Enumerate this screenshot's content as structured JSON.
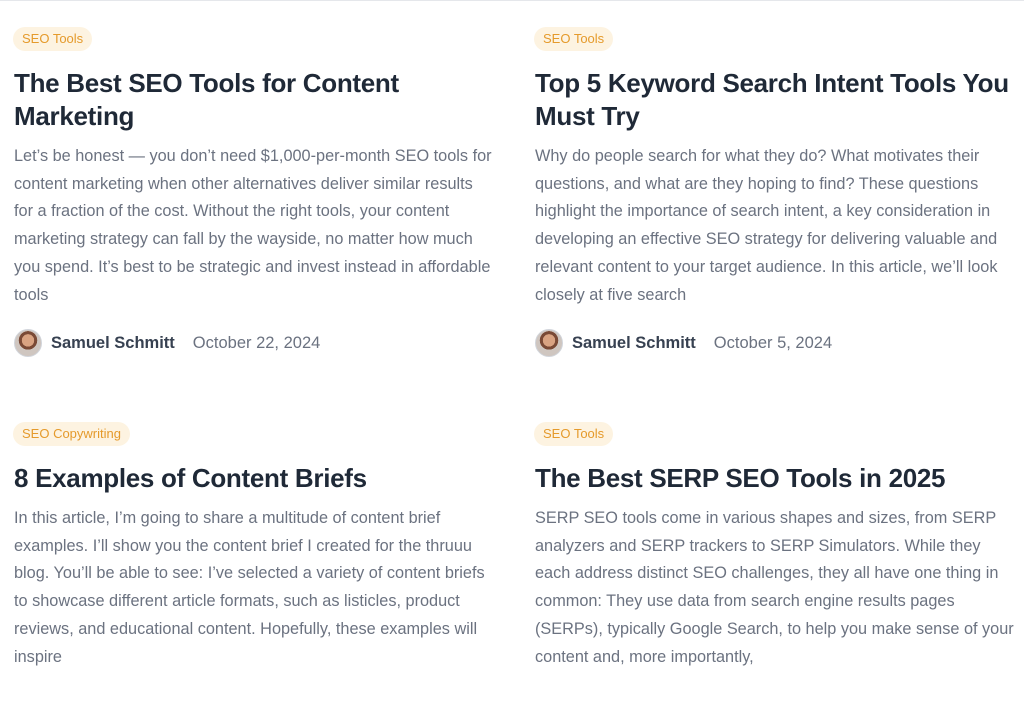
{
  "posts": [
    {
      "category": "SEO Tools",
      "title": "The Best SEO Tools for Content Marketing",
      "excerpt": "Let’s be honest — you don’t need $1,000-per-month SEO tools for content marketing when other alternatives deliver similar results for a fraction of the cost.  Without the right tools, your content marketing strategy can fall by the wayside, no matter how much you spend. It’s best to be strategic and invest instead in affordable tools",
      "author": "Samuel Schmitt",
      "date": "October 22, 2024"
    },
    {
      "category": "SEO Tools",
      "title": "Top 5 Keyword Search Intent Tools You Must Try",
      "excerpt": "Why do people search for what they do? What motivates their questions, and what are they hoping to find? These questions highlight the importance of search intent, a key consideration in developing an effective SEO strategy for delivering valuable and relevant content to your target audience.  In this article, we’ll look closely at five search",
      "author": "Samuel Schmitt",
      "date": "October 5, 2024"
    },
    {
      "category": "SEO Copywriting",
      "title": "8 Examples of Content Briefs",
      "excerpt": "In this article, I’m going to share a multitude of content brief examples. I’ll show you the content brief I created for the thruuu blog. You’ll be able to see: I’ve selected a variety of content briefs to showcase different article formats, such as listicles, product reviews, and educational content. Hopefully, these examples will inspire"
    },
    {
      "category": "SEO Tools",
      "title": "The Best SERP SEO Tools in 2025",
      "excerpt": "SERP SEO tools come in various shapes and sizes, from SERP analyzers and SERP trackers to SERP Simulators. While they each address distinct SEO challenges, they all have one thing in common: They use data from search engine results pages (SERPs), typically Google Search, to help you make sense of your content and, more importantly,"
    }
  ]
}
